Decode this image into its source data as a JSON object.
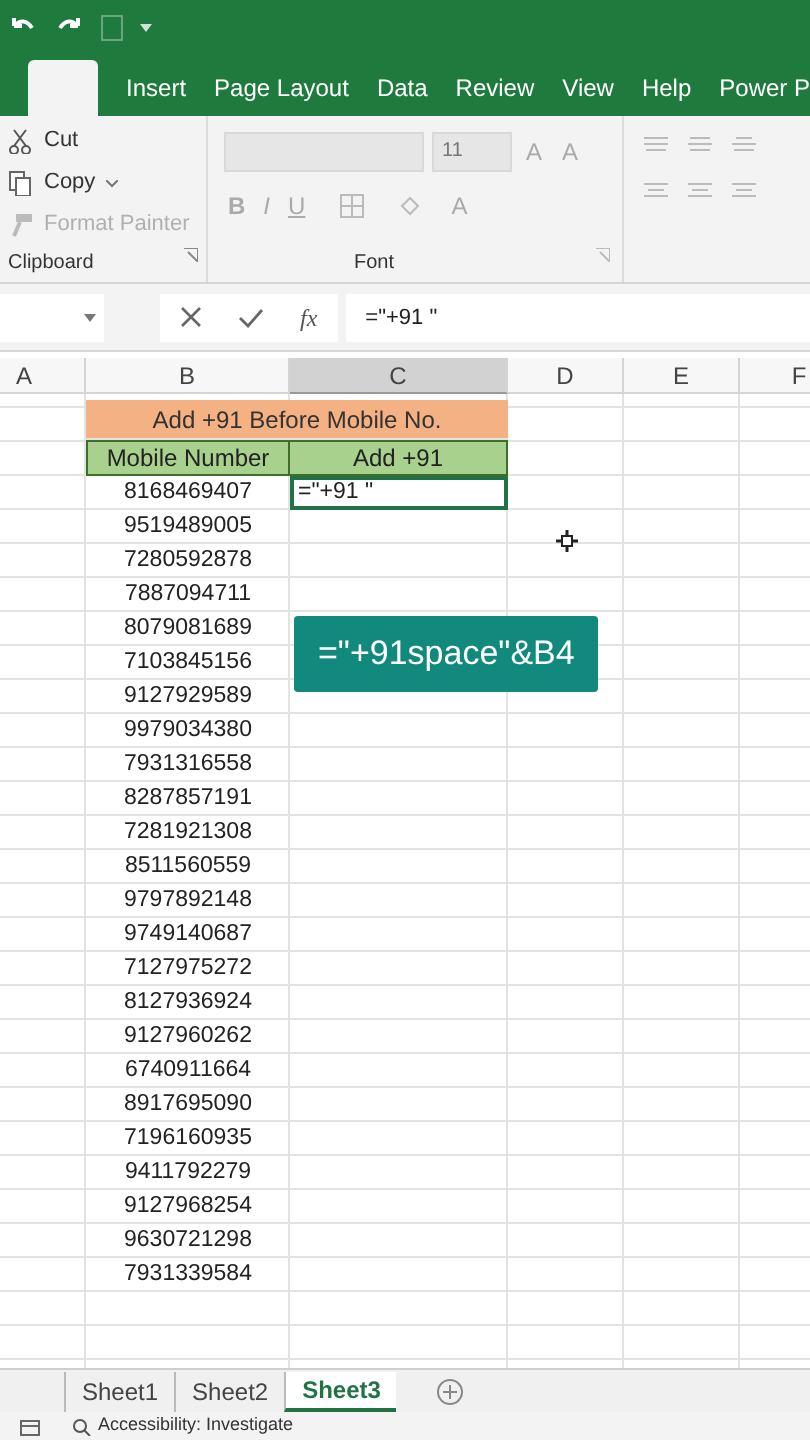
{
  "ribbon_tabs": [
    {
      "selected": true
    },
    {
      "label": "Insert",
      "selected": false
    },
    {
      "label": "Page Layout",
      "selected": false
    },
    {
      "label": "Data",
      "selected": false
    },
    {
      "label": "Review",
      "selected": false
    },
    {
      "label": "View",
      "selected": false
    },
    {
      "label": "Help",
      "selected": false
    },
    {
      "label": "Power P",
      "selected": false
    }
  ],
  "clipboard": {
    "items": [
      {
        "kind": "cut",
        "label": "Cut",
        "disabled": false
      },
      {
        "kind": "copy",
        "label": "Copy",
        "disabled": false
      },
      {
        "kind": "painter",
        "label": "Format Painter",
        "disabled": true
      }
    ],
    "group_label": "Clipboard"
  },
  "font": {
    "size": "11",
    "grow_shrink": [
      "A",
      "A"
    ],
    "format_buttons": [
      "B",
      "I",
      "U"
    ],
    "font_color": "A",
    "group_label": "Font"
  },
  "formula_bar": {
    "fx": "fx",
    "formula": "=\"+91 \""
  },
  "columns": [
    {
      "label": "A",
      "selected": false
    },
    {
      "label": "B",
      "selected": false
    },
    {
      "label": "C",
      "selected": true
    },
    {
      "label": "D",
      "selected": false
    },
    {
      "label": "E",
      "selected": false
    },
    {
      "label": "F",
      "selected": false
    }
  ],
  "title": "Add +91 Before Mobile No.",
  "headers": [
    "Mobile Number",
    "Add +91"
  ],
  "rows": [
    {
      "number": "8168469407",
      "result": "=\"+91 \"",
      "active": true
    },
    {
      "number": "9519489005",
      "active": false
    },
    {
      "number": "7280592878",
      "active": false
    },
    {
      "number": "7887094711",
      "active": false
    },
    {
      "number": "8079081689",
      "active": false
    },
    {
      "number": "7103845156",
      "active": false
    },
    {
      "number": "9127929589",
      "active": false
    },
    {
      "number": "9979034380",
      "active": false
    },
    {
      "number": "7931316558",
      "active": false
    },
    {
      "number": "8287857191",
      "active": false
    },
    {
      "number": "7281921308",
      "active": false
    },
    {
      "number": "8511560559",
      "active": false
    },
    {
      "number": "9797892148",
      "active": false
    },
    {
      "number": "9749140687",
      "active": false
    },
    {
      "number": "7127975272",
      "active": false
    },
    {
      "number": "8127936924",
      "active": false
    },
    {
      "number": "9127960262",
      "active": false
    },
    {
      "number": "6740911664",
      "active": false
    },
    {
      "number": "8917695090",
      "active": false
    },
    {
      "number": "7196160935",
      "active": false
    },
    {
      "number": "9411792279",
      "active": false
    },
    {
      "number": "9127968254",
      "active": false
    },
    {
      "number": "9630721298",
      "active": false
    },
    {
      "number": "7931339584",
      "active": false
    }
  ],
  "overlay": "=\"+91space\"&B4",
  "sheet_tabs": [
    {
      "label": "Sheet1",
      "selected": false
    },
    {
      "label": "Sheet2",
      "selected": false
    },
    {
      "label": "Sheet3",
      "selected": true
    }
  ],
  "status": "Accessibility: Investigate"
}
